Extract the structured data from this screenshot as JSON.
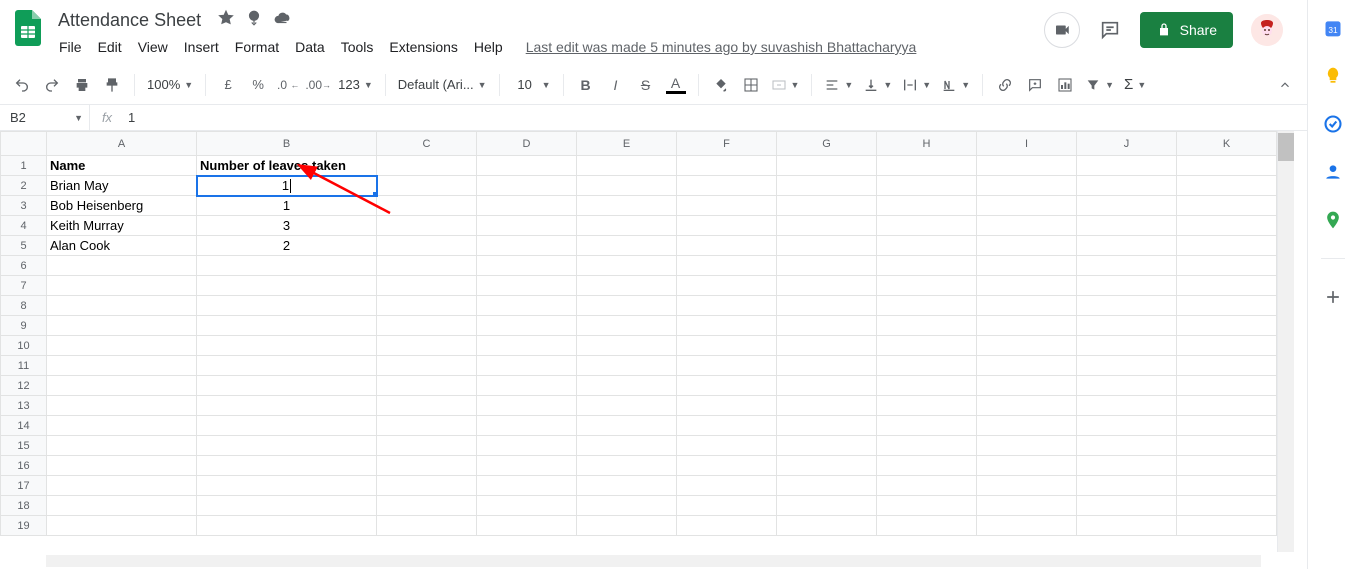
{
  "doc": {
    "title": "Attendance Sheet"
  },
  "menus": [
    "File",
    "Edit",
    "View",
    "Insert",
    "Format",
    "Data",
    "Tools",
    "Extensions",
    "Help"
  ],
  "last_edit": "Last edit was made 5 minutes ago by suvashish Bhattacharyya",
  "share": {
    "label": "Share"
  },
  "toolbar": {
    "zoom": "100%",
    "currency": "£",
    "percent": "%",
    "dec_dec": ".0",
    "dec_inc": ".00",
    "more_fmt": "123",
    "font": "Default (Ari...",
    "font_size": "10"
  },
  "namebox": {
    "ref": "B2",
    "formula": "1"
  },
  "columns": [
    "A",
    "B",
    "C",
    "D",
    "E",
    "F",
    "G",
    "H",
    "I",
    "J",
    "K"
  ],
  "row_count": 19,
  "headers": {
    "A": "Name",
    "B": "Number of leaves taken"
  },
  "rows": [
    {
      "A": "Brian May",
      "B": "1"
    },
    {
      "A": "Bob Heisenberg",
      "B": "1"
    },
    {
      "A": "Keith  Murray",
      "B": "3"
    },
    {
      "A": "Alan Cook",
      "B": "2"
    }
  ],
  "selected": {
    "row": 2,
    "col": "B"
  }
}
